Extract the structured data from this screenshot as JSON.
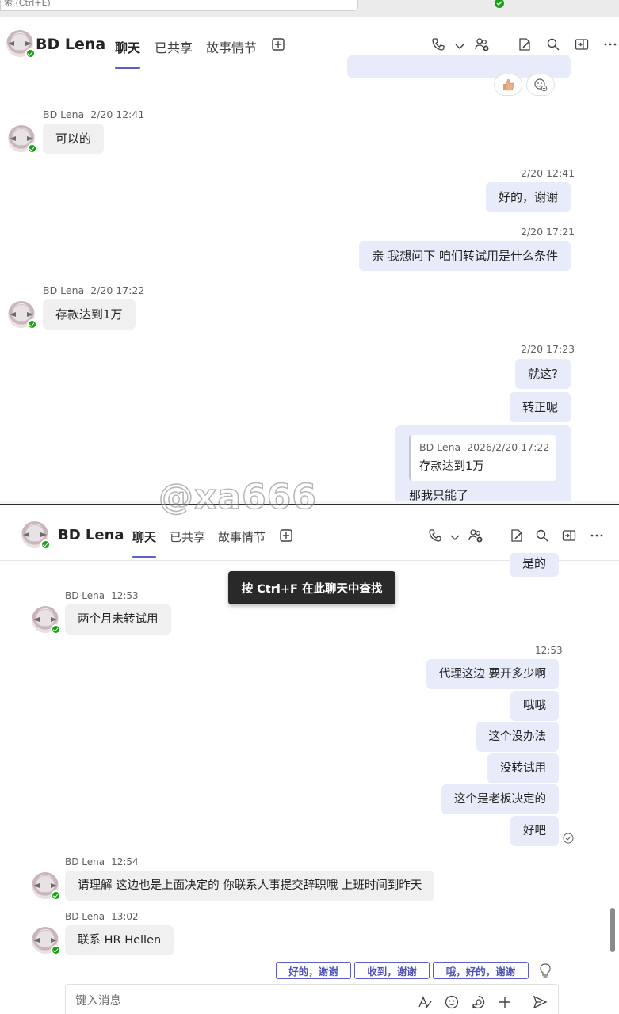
{
  "top_strip": {
    "search_text": "索 (Ctrl+E)"
  },
  "header": {
    "contact_name": "BD Lena",
    "tabs": [
      "聊天",
      "已共享",
      "故事情节"
    ],
    "add_tab": "+"
  },
  "panel1": {
    "messages": [
      {
        "sender": "BD Lena",
        "time": "2/20 12:41",
        "text": "可以的"
      },
      {
        "time": "2/20 12:41",
        "text": "好的，谢谢"
      },
      {
        "time": "2/20 17:21",
        "text": "亲 我想问下 咱们转试用是什么条件"
      },
      {
        "sender": "BD Lena",
        "time": "2/20 17:22",
        "text": "存款达到1万"
      },
      {
        "time": "2/20 17:23",
        "texts": [
          "就这?",
          "转正呢"
        ]
      }
    ],
    "quote": {
      "sender": "BD Lena",
      "time": "2026/2/20 17:22",
      "text": "存款达到1万",
      "reply_partial": "那我只能了"
    }
  },
  "watermark": "@xa666",
  "panel2": {
    "tooltip": "按 Ctrl+F 在此聊天中查找",
    "top_partial_bubble": "是的",
    "messages": [
      {
        "sender": "BD Lena",
        "time": "12:53",
        "text": "两个月未转试用"
      },
      {
        "time": "12:53",
        "texts": [
          "代理这边 要开多少啊",
          "哦哦",
          "这个没办法",
          "没转试用",
          "这个是老板决定的",
          "好吧"
        ]
      },
      {
        "sender": "BD Lena",
        "time": "12:54",
        "text": "请理解 这边也是上面决定的 你联系人事提交辞职哦 上班时间到昨天"
      },
      {
        "sender": "BD Lena",
        "time": "13:02",
        "text": "联系 HR Hellen"
      }
    ],
    "suggested_replies": [
      "好的，谢谢",
      "收到，谢谢",
      "哦，好的，谢谢"
    ],
    "composer": {
      "placeholder": "键入消息",
      "value": ""
    }
  },
  "colors": {
    "accent": "#5b5fc7",
    "outgoing_bubble": "#e8ebfa",
    "incoming_bubble": "#f0f0f0",
    "presence": "#13a10e"
  },
  "icons": [
    "phone-icon",
    "chevron-down-icon",
    "add-people-icon",
    "pop-out-icon",
    "search-icon",
    "open-panel-icon",
    "more-icon",
    "thumbs-up-icon",
    "add-reaction-icon",
    "format-icon",
    "emoji-icon",
    "loop-icon",
    "plus-icon",
    "send-icon",
    "lightbulb-icon",
    "read-receipt-icon"
  ]
}
